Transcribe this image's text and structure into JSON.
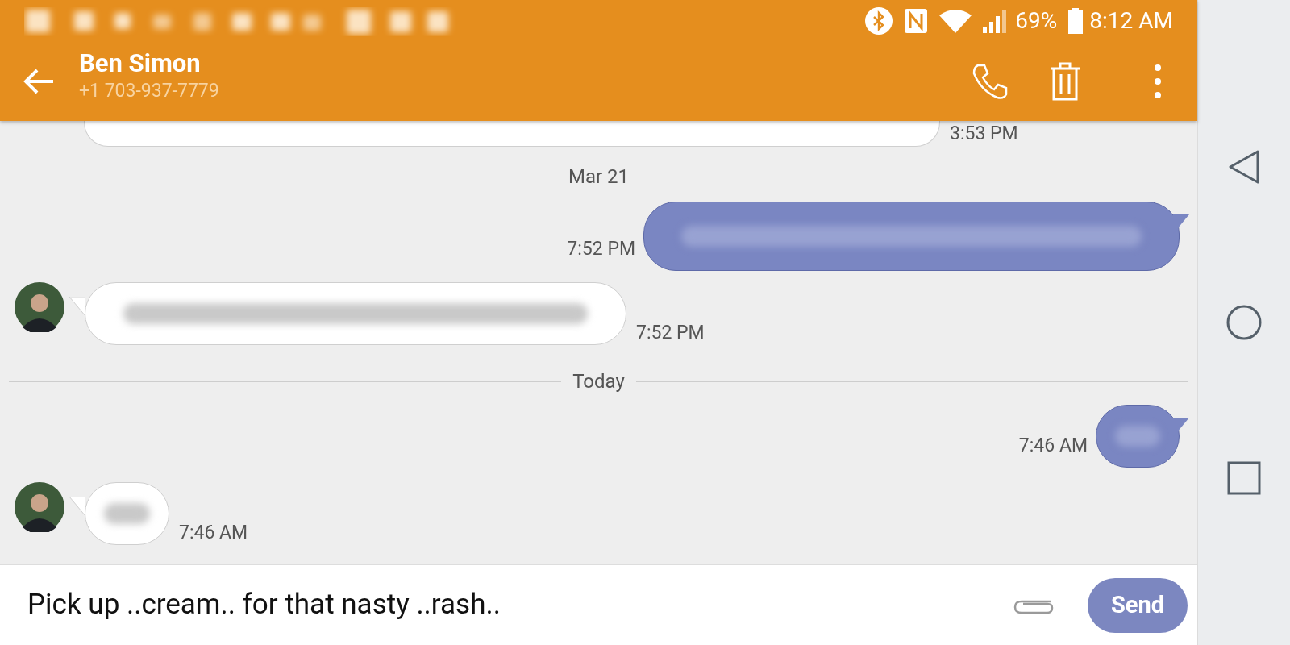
{
  "status_bar": {
    "battery": "69%",
    "time": "8:12 AM"
  },
  "header": {
    "name": "Ben Simon",
    "number": "+1 703-937-7779"
  },
  "messages": [
    {
      "kind": "partial",
      "time": "3:53 PM"
    },
    {
      "kind": "divider",
      "label": "Mar 21"
    },
    {
      "kind": "sent-long",
      "time": "7:52 PM"
    },
    {
      "kind": "received-long",
      "time": "7:52 PM"
    },
    {
      "kind": "divider",
      "label": "Today"
    },
    {
      "kind": "sent-short",
      "time": "7:46 AM"
    },
    {
      "kind": "received-short",
      "time": "7:46 AM"
    }
  ],
  "composer": {
    "value": "Pick up ..cream.. for that nasty ..rash..",
    "send": "Send"
  }
}
